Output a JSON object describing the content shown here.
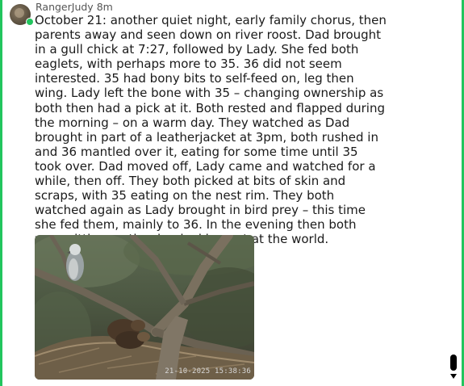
{
  "post": {
    "author": "RangerJudy",
    "time": "8m",
    "message": "October 21: another quiet night, early family chorus, then parents away and seen down on river roost. Dad brought in a gull chick at 7:27, followed by Lady. She fed both eaglets, with perhaps more to 35. 36 did not seem interested. 35 had bony bits to self-feed on, leg then wing. Lady left the bone with 35 – changing ownership as both then had a pick at it. Both rested and flapped during the morning – on a warm day. They watched as Dad brought in part of a leatherjacket at 3pm, both rushed in and 36 mantled over it, eating for some time until 35 took over. Dad moved off, Lady came and watched for a while, then off. They both picked at bits of skin and scraps, with 35 eating on the nest rim. They both watched again as Lady brought in bird prey – this time she fed them, mainly to 36. In the evening then both were sitting on the rim, looking out at the world.",
    "image": {
      "timestamp": "21-10-2025 15:38:36"
    }
  },
  "colors": {
    "accent": "#22c55e",
    "text": "#1a1a1a",
    "meta": "#555555"
  },
  "icons": {
    "avatar": "user-avatar",
    "online": "online-status-dot",
    "scroll_down": "chevron-down-icon"
  }
}
